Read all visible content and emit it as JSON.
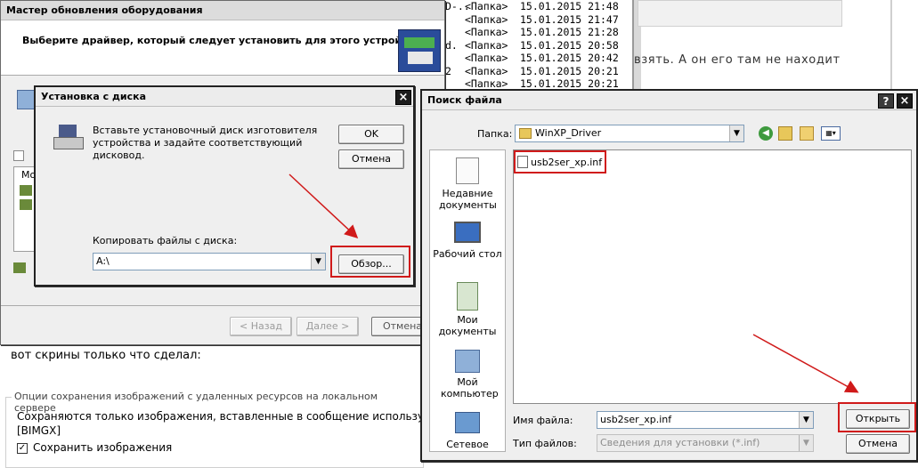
{
  "bg_listing": {
    "rows": [
      {
        "name": "D-..",
        "type": "<Папка>",
        "date": "15.01.2015 21:48"
      },
      {
        "name": "",
        "type": "<Папка>",
        "date": "15.01.2015 21:47"
      },
      {
        "name": "",
        "type": "<Папка>",
        "date": "15.01.2015 21:28"
      },
      {
        "name": "d.",
        "type": "<Папка>",
        "date": "15.01.2015 20:58"
      },
      {
        "name": "",
        "type": "<Папка>",
        "date": "15.01.2015 20:42"
      },
      {
        "name": "2",
        "type": "<Папка>",
        "date": "15.01.2015 20:21"
      },
      {
        "name": "",
        "type": "<Папка>",
        "date": "15.01.2015 20:21"
      }
    ]
  },
  "bg_forum": {
    "snippet_right": "взять. А он его там не находит",
    "post_text": "вот скрины только что сделал:",
    "options_legend": "Опции сохранения изображений с удаленных ресурсов на локальном сервере",
    "options_line1": "Сохраняются только изображения, вставленные в сообщение используя бб",
    "options_line2": "[BIMGX]",
    "save_images_label": "Сохранить изображения"
  },
  "wizard": {
    "title": "Мастер обновления оборудования",
    "heading": "Выберите драйвер, который следует установить для этого устройства.",
    "col_header": "Мо",
    "back_label": "< Назад",
    "next_label": "Далее >",
    "cancel_label": "Отмена"
  },
  "disk_dialog": {
    "title": "Установка с диска",
    "message": "Вставьте установочный диск изготовителя устройства и задайте соответствующий дисковод.",
    "ok_label": "OK",
    "cancel_label": "Отмена",
    "copy_from_label": "Копировать файлы с диска:",
    "copy_from_value": "A:\\",
    "browse_label": "Обзор..."
  },
  "file_dialog": {
    "title": "Поиск файла",
    "help_label": "?",
    "close_label": "×",
    "folder_label": "Папка:",
    "folder_value": "WinXP_Driver",
    "places": [
      {
        "label": "Недавние документы",
        "icon": "recent-documents-icon"
      },
      {
        "label": "Рабочий стол",
        "icon": "desktop-icon"
      },
      {
        "label": "Мои документы",
        "icon": "my-documents-icon"
      },
      {
        "label": "Мой компьютер",
        "icon": "my-computer-icon"
      },
      {
        "label": "Сетевое",
        "icon": "network-icon"
      }
    ],
    "file_item": "usb2ser_xp.inf",
    "filename_label": "Имя файла:",
    "filename_value": "usb2ser_xp.inf",
    "filetype_label": "Тип файлов:",
    "filetype_value": "Сведения для установки (*.inf)",
    "open_label": "Открыть",
    "cancel_label": "Отмена"
  },
  "colors": {
    "annotation_red": "#d01a1a",
    "dialog_bg": "#ece9d8"
  }
}
